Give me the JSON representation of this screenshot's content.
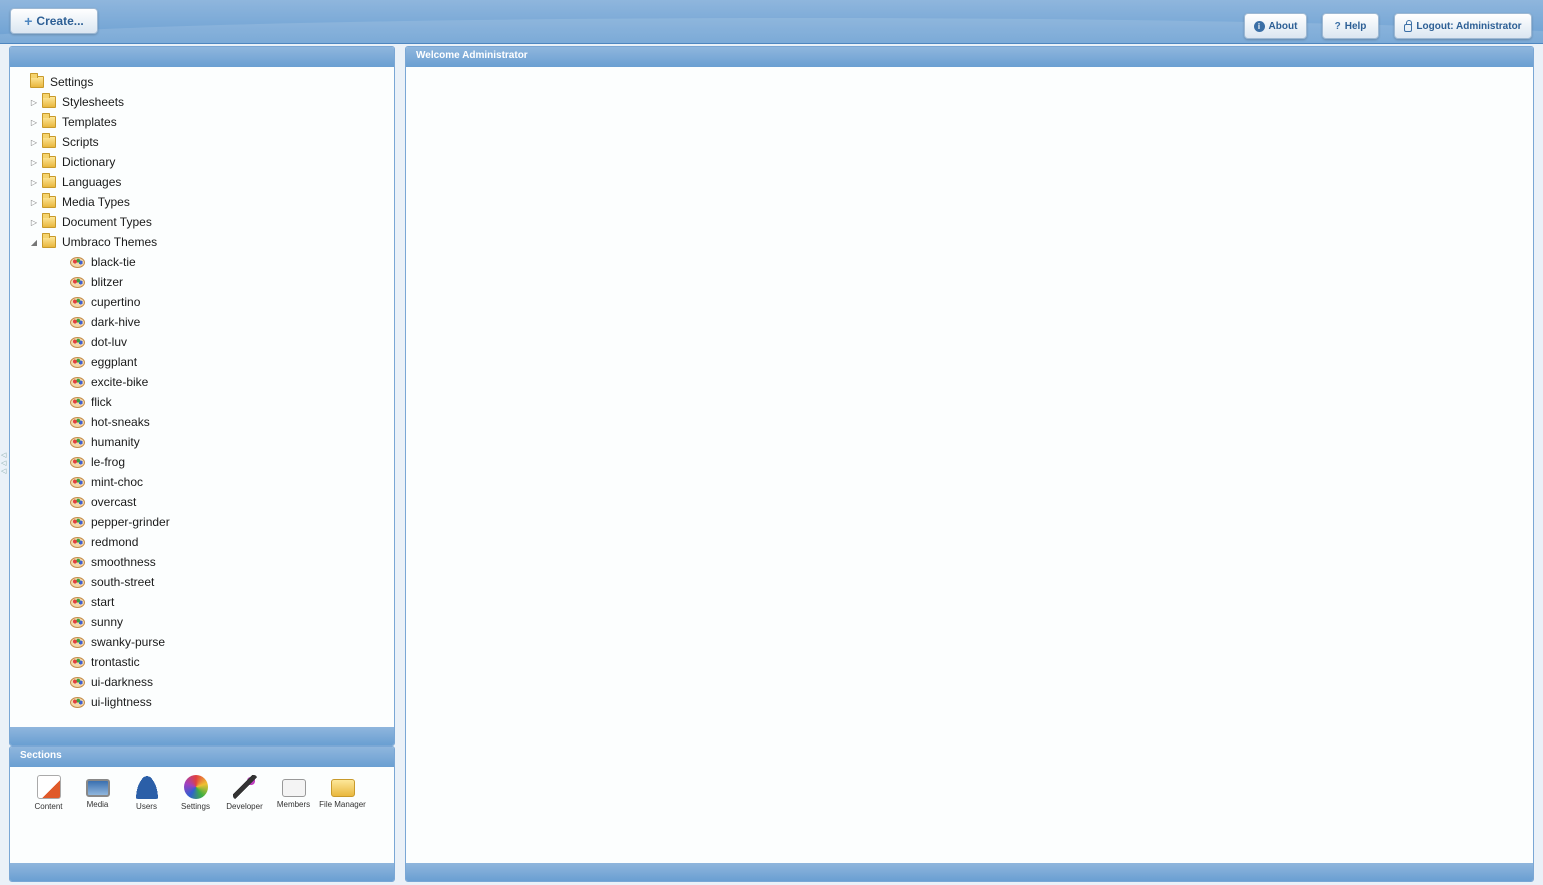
{
  "topbar": {
    "create_label": "Create...",
    "about_label": "About",
    "help_label": "Help",
    "logout_label": "Logout: Administrator"
  },
  "main": {
    "title": "Welcome Administrator"
  },
  "tree": {
    "root": "Settings",
    "folders": [
      "Stylesheets",
      "Templates",
      "Scripts",
      "Dictionary",
      "Languages",
      "Media Types",
      "Document Types"
    ],
    "expanded_folder": "Umbraco Themes",
    "themes": [
      "black-tie",
      "blitzer",
      "cupertino",
      "dark-hive",
      "dot-luv",
      "eggplant",
      "excite-bike",
      "flick",
      "hot-sneaks",
      "humanity",
      "le-frog",
      "mint-choc",
      "overcast",
      "pepper-grinder",
      "redmond",
      "smoothness",
      "south-street",
      "start",
      "sunny",
      "swanky-purse",
      "trontastic",
      "ui-darkness",
      "ui-lightness"
    ]
  },
  "sections": {
    "title": "Sections",
    "items": [
      {
        "label": "Content",
        "icon": "content-icon"
      },
      {
        "label": "Media",
        "icon": "media-icon"
      },
      {
        "label": "Users",
        "icon": "users-icon"
      },
      {
        "label": "Settings",
        "icon": "settings-icon"
      },
      {
        "label": "Developer",
        "icon": "developer-icon"
      },
      {
        "label": "Members",
        "icon": "members-icon"
      },
      {
        "label": "File Manager",
        "icon": "file-manager-icon"
      }
    ]
  }
}
